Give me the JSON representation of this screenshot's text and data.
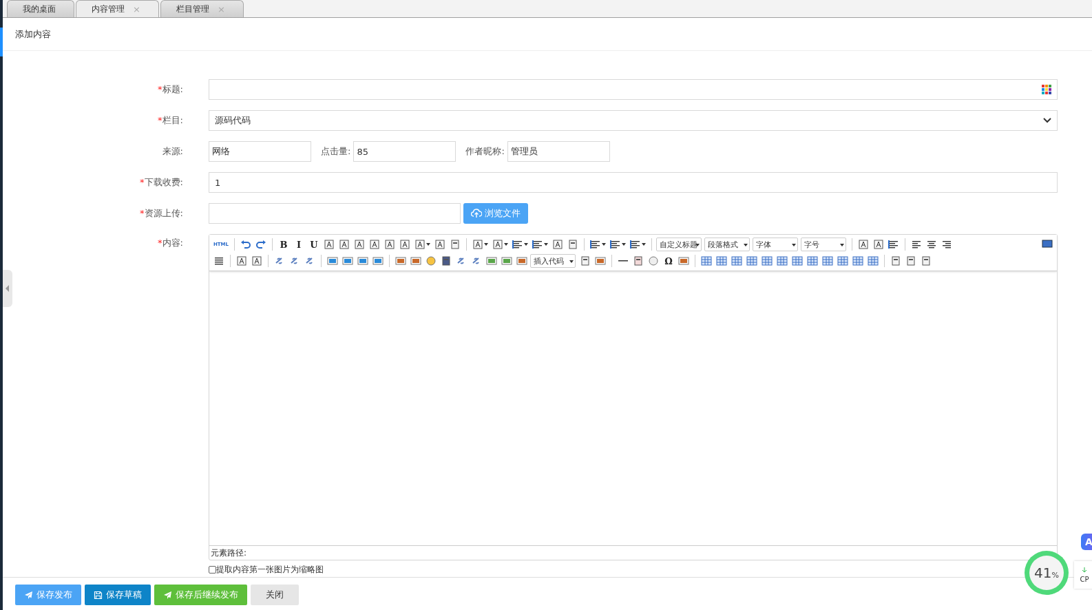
{
  "tabs": [
    {
      "label": "我的桌面",
      "selected": false
    },
    {
      "label": "内容管理",
      "selected": true,
      "close": "×"
    },
    {
      "label": "栏目管理",
      "selected": false,
      "close": "×"
    }
  ],
  "page_title": "添加内容",
  "form": {
    "fields": [
      {
        "kind": "text_picker",
        "label": "标题:",
        "required": true
      },
      {
        "kind": "select",
        "label": "栏目:",
        "required": true,
        "value": "源码代码"
      },
      {
        "kind": "inline",
        "label": "来源:",
        "required": false,
        "value": "网络",
        "extra": [
          {
            "label": "点击量:",
            "value": "85"
          },
          {
            "label": "作者昵称:",
            "value": "管理员"
          }
        ]
      },
      {
        "kind": "text",
        "label": "下载收费:",
        "required": true,
        "value": "1"
      },
      {
        "kind": "file",
        "label": "资源上传:",
        "required": true,
        "button": "浏览文件"
      }
    ],
    "required_mark": "*",
    "editor_label": "内容:",
    "editor_required": true
  },
  "toolbar": [
    [
      {
        "kind": "glyph",
        "text": "HTML"
      },
      {
        "kind": "sep"
      },
      {
        "kind": "icon"
      },
      {
        "kind": "icon"
      },
      {
        "kind": "sep"
      },
      {
        "kind": "glyph",
        "text": "B"
      },
      {
        "kind": "glyph",
        "text": "I"
      },
      {
        "kind": "glyph",
        "text": "U"
      },
      {
        "kind": "icon"
      },
      {
        "kind": "icon"
      },
      {
        "kind": "icon"
      },
      {
        "kind": "icon"
      },
      {
        "kind": "icon"
      },
      {
        "kind": "icon"
      },
      {
        "kind": "icon",
        "dropdown": true
      },
      {
        "kind": "icon"
      },
      {
        "kind": "icon"
      },
      {
        "kind": "sep"
      },
      {
        "kind": "icon",
        "dropdown": true
      },
      {
        "kind": "icon",
        "dropdown": true
      },
      {
        "kind": "icon",
        "dropdown": true
      },
      {
        "kind": "icon",
        "dropdown": true
      },
      {
        "kind": "icon"
      },
      {
        "kind": "icon"
      },
      {
        "kind": "sep"
      },
      {
        "kind": "icon",
        "dropdown": true
      },
      {
        "kind": "icon",
        "dropdown": true
      },
      {
        "kind": "icon",
        "dropdown": true
      },
      {
        "kind": "sep"
      },
      {
        "kind": "select",
        "label": "自定义标题"
      },
      {
        "kind": "select",
        "label": "段落格式"
      },
      {
        "kind": "select",
        "label": "字体"
      },
      {
        "kind": "select",
        "label": "字号"
      },
      {
        "kind": "sep"
      },
      {
        "kind": "icon"
      },
      {
        "kind": "icon"
      },
      {
        "kind": "icon"
      },
      {
        "kind": "sep"
      },
      {
        "kind": "icon"
      },
      {
        "kind": "icon"
      },
      {
        "kind": "icon"
      },
      {
        "kind": "spacer"
      },
      {
        "kind": "icon"
      }
    ],
    [
      {
        "kind": "icon"
      },
      {
        "kind": "sep"
      },
      {
        "kind": "icon"
      },
      {
        "kind": "icon"
      },
      {
        "kind": "sep"
      },
      {
        "kind": "icon"
      },
      {
        "kind": "icon"
      },
      {
        "kind": "icon"
      },
      {
        "kind": "sep"
      },
      {
        "kind": "icon"
      },
      {
        "kind": "icon"
      },
      {
        "kind": "icon"
      },
      {
        "kind": "icon"
      },
      {
        "kind": "sep"
      },
      {
        "kind": "icon"
      },
      {
        "kind": "icon"
      },
      {
        "kind": "icon"
      },
      {
        "kind": "icon"
      },
      {
        "kind": "icon"
      },
      {
        "kind": "icon"
      },
      {
        "kind": "icon"
      },
      {
        "kind": "icon"
      },
      {
        "kind": "icon"
      },
      {
        "kind": "select",
        "label": "插入代码"
      },
      {
        "kind": "icon"
      },
      {
        "kind": "icon"
      },
      {
        "kind": "sep"
      },
      {
        "kind": "icon"
      },
      {
        "kind": "icon"
      },
      {
        "kind": "icon"
      },
      {
        "kind": "glyph",
        "text": "Ω"
      },
      {
        "kind": "icon"
      },
      {
        "kind": "sep"
      },
      {
        "kind": "icon"
      },
      {
        "kind": "icon"
      },
      {
        "kind": "icon"
      },
      {
        "kind": "icon"
      },
      {
        "kind": "icon"
      },
      {
        "kind": "icon"
      },
      {
        "kind": "icon"
      },
      {
        "kind": "icon"
      },
      {
        "kind": "icon"
      },
      {
        "kind": "icon"
      },
      {
        "kind": "icon"
      },
      {
        "kind": "icon"
      },
      {
        "kind": "sep"
      },
      {
        "kind": "icon"
      },
      {
        "kind": "icon"
      },
      {
        "kind": "icon"
      }
    ]
  ],
  "element_path": "元素路径:",
  "thumbnail_option": {
    "label": "提取内容第一张图片为缩略图",
    "checked": false
  },
  "buttons": [
    {
      "label": "保存发布"
    },
    {
      "label": "保存草稿"
    },
    {
      "label": "保存后继续发布"
    },
    {
      "label": "关闭"
    }
  ],
  "monitor": {
    "percent": "41",
    "unit": "%",
    "label": "CP"
  },
  "assistant_badge": "A"
}
